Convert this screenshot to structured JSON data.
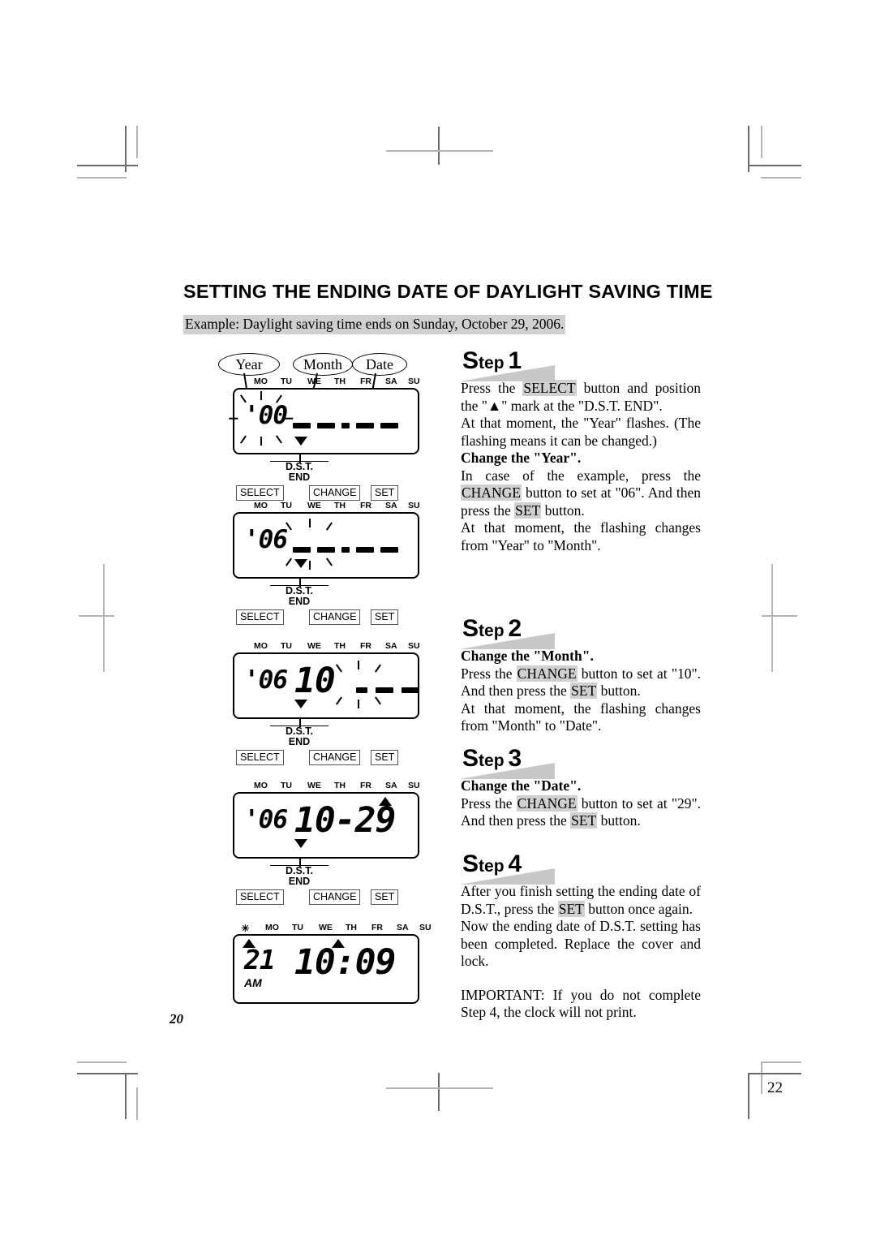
{
  "document": {
    "title": "SETTING THE ENDING DATE OF DAYLIGHT SAVING TIME",
    "example": "Example: Daylight saving time ends on Sunday, October 29, 2006.",
    "page_number_inner": "20",
    "page_number_outer": "22"
  },
  "callouts": {
    "year": "Year",
    "month": "Month",
    "date": "Date"
  },
  "days": [
    "MO",
    "TU",
    "WE",
    "TH",
    "FR",
    "SA",
    "SU"
  ],
  "marker": {
    "dst_line1": "D.S.T.",
    "dst_line2": "END"
  },
  "buttons": {
    "select": "SELECT",
    "change": "CHANGE",
    "set": "SET"
  },
  "panels": [
    {
      "name": "panel-year-flashing",
      "year": "'00",
      "month": "",
      "date": "",
      "dashes": true,
      "flash_target": "year",
      "dst_marker": "down",
      "sun_icon": false,
      "buttons": true
    },
    {
      "name": "panel-year-set",
      "year": "'06",
      "month": "",
      "date": "",
      "dashes": true,
      "flash_target": "month",
      "dst_marker": "down",
      "sun_icon": false,
      "buttons": true
    },
    {
      "name": "panel-month-set",
      "year": "'06",
      "month": "10",
      "date": "",
      "dashes": true,
      "flash_target": "date",
      "dst_marker": "down",
      "sun_icon": false,
      "buttons": true
    },
    {
      "name": "panel-date-set",
      "year": "'06",
      "month": "10-29",
      "date": "",
      "dashes": false,
      "flash_target": "none",
      "dst_marker": "down",
      "sunday_marker": "up",
      "sun_icon": false,
      "buttons": true
    },
    {
      "name": "panel-normal-time",
      "year": "21",
      "month": "10:09",
      "am_label": "AM",
      "dashes": false,
      "flash_target": "none",
      "dst_marker": "none",
      "sun_icon": true,
      "buttons": false
    }
  ],
  "steps": [
    {
      "label_s": "S",
      "label_tep": "tep",
      "number": "1",
      "paragraphs": [
        {
          "parts": [
            {
              "t": "Press the ",
              "style": "normal"
            },
            {
              "t": "SELECT",
              "style": "highlight"
            },
            {
              "t": " button and position the \"▲\" mark at the \"D.S.T. END\".",
              "style": "normal"
            }
          ]
        },
        {
          "parts": [
            {
              "t": "At that moment, the \"Year\" flashes. (The flashing means it can be changed.)",
              "style": "normal"
            }
          ]
        },
        {
          "parts": [
            {
              "t": "Change the \"Year\".",
              "style": "bold"
            }
          ]
        },
        {
          "parts": [
            {
              "t": "In case of the example, press the ",
              "style": "normal"
            },
            {
              "t": "CHANGE",
              "style": "highlight"
            },
            {
              "t": " button to set at \"06\". And then press the ",
              "style": "normal"
            },
            {
              "t": "SET",
              "style": "highlight"
            },
            {
              "t": " button.",
              "style": "normal"
            }
          ]
        },
        {
          "parts": [
            {
              "t": "At that moment, the flashing changes from \"Year\" to \"Month\".",
              "style": "normal"
            }
          ]
        }
      ]
    },
    {
      "label_s": "S",
      "label_tep": "tep",
      "number": "2",
      "paragraphs": [
        {
          "parts": [
            {
              "t": "Change the \"Month\".",
              "style": "bold"
            }
          ]
        },
        {
          "parts": [
            {
              "t": "Press the ",
              "style": "normal"
            },
            {
              "t": "CHANGE",
              "style": "highlight"
            },
            {
              "t": " button to set at \"10\". And then press the ",
              "style": "normal"
            },
            {
              "t": "SET",
              "style": "highlight"
            },
            {
              "t": " button.",
              "style": "normal"
            }
          ]
        },
        {
          "parts": [
            {
              "t": "At that moment, the flashing changes from \"Month\" to \"Date\".",
              "style": "normal"
            }
          ]
        }
      ]
    },
    {
      "label_s": "S",
      "label_tep": "tep",
      "number": "3",
      "paragraphs": [
        {
          "parts": [
            {
              "t": "Change the \"Date\".",
              "style": "bold"
            }
          ]
        },
        {
          "parts": [
            {
              "t": "Press the ",
              "style": "normal"
            },
            {
              "t": "CHANGE",
              "style": "highlight"
            },
            {
              "t": " button to set at \"29\". And then press the ",
              "style": "normal"
            },
            {
              "t": "SET",
              "style": "highlight"
            },
            {
              "t": " button.",
              "style": "normal"
            }
          ]
        }
      ]
    },
    {
      "label_s": "S",
      "label_tep": "tep",
      "number": "4",
      "paragraphs": [
        {
          "parts": [
            {
              "t": "After you finish setting the ending date of D.S.T., press the ",
              "style": "normal"
            },
            {
              "t": "SET",
              "style": "highlight"
            },
            {
              "t": " button once again.",
              "style": "normal"
            }
          ]
        },
        {
          "parts": [
            {
              "t": "Now the ending date of D.S.T. setting has been completed. Replace the cover and lock.",
              "style": "normal"
            }
          ]
        },
        {
          "parts": [
            {
              "t": "IMPORTANT: If you do not complete Step 4, the clock will not print.",
              "style": "normal"
            }
          ]
        }
      ]
    }
  ]
}
